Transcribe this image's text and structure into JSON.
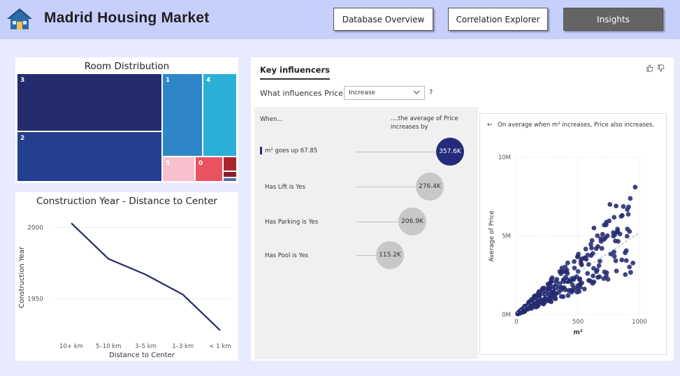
{
  "header": {
    "title": "Madrid Housing Market",
    "nav": [
      {
        "label": "Database Overview",
        "active": false
      },
      {
        "label": "Correlation Explorer",
        "active": false
      },
      {
        "label": "Insights",
        "active": true
      }
    ]
  },
  "room_distribution": {
    "title": "Room Distribution",
    "cells": [
      {
        "label": "3",
        "color": "#252b6f"
      },
      {
        "label": "2",
        "color": "#243f8f"
      },
      {
        "label": "1",
        "color": "#2e86c8"
      },
      {
        "label": "4",
        "color": "#2ab0d6"
      },
      {
        "label": "5",
        "color": "#f7c0cc"
      },
      {
        "label": "0",
        "color": "#e8535f"
      },
      {
        "label": "",
        "color": "#a8272f"
      },
      {
        "label": "",
        "color": "#8a1d2a"
      },
      {
        "label": "",
        "color": "#5a6aa8"
      }
    ]
  },
  "chart_data": [
    {
      "type": "line",
      "title": "Construction Year - Distance to Center",
      "xlabel": "Distance to Center",
      "ylabel": "Construction Year",
      "categories": [
        "10+ km",
        "5–10 km",
        "3–5 km",
        "1–3 km",
        "< 1 km"
      ],
      "values": [
        2003,
        1978,
        1967,
        1953,
        1928
      ],
      "yticks": [
        "2000",
        "1950"
      ],
      "ylim": [
        1920,
        2010
      ],
      "color": "#252b6f",
      "grid": true
    },
    {
      "type": "scatter",
      "xlabel": "m²",
      "ylabel": "Average of Price",
      "xticks": [
        "0",
        "500",
        "1000"
      ],
      "yticks": [
        "0M",
        "5M",
        "10M"
      ],
      "xlim": [
        0,
        1000
      ],
      "ylim": [
        0,
        10000000
      ],
      "color": "#252b6f",
      "trend": "dashed"
    }
  ],
  "key_influencers": {
    "tab": "Key influencers",
    "question": "What influences Price to",
    "selected": "Increase",
    "help": "?",
    "when_header": "When...",
    "avg_header_1": "....the average of Price",
    "avg_header_2": "increases by",
    "influencers": [
      {
        "label": "m² goes up 67.85",
        "value": "357.6K"
      },
      {
        "label": "Has Lift is Yes",
        "value": "276.4K"
      },
      {
        "label": "Has Parking is Yes",
        "value": "206.9K"
      },
      {
        "label": "Has Pool is Yes",
        "value": "115.2K"
      }
    ],
    "detail_back": "←",
    "detail_text": "On average when m² increases, Price also increases."
  }
}
